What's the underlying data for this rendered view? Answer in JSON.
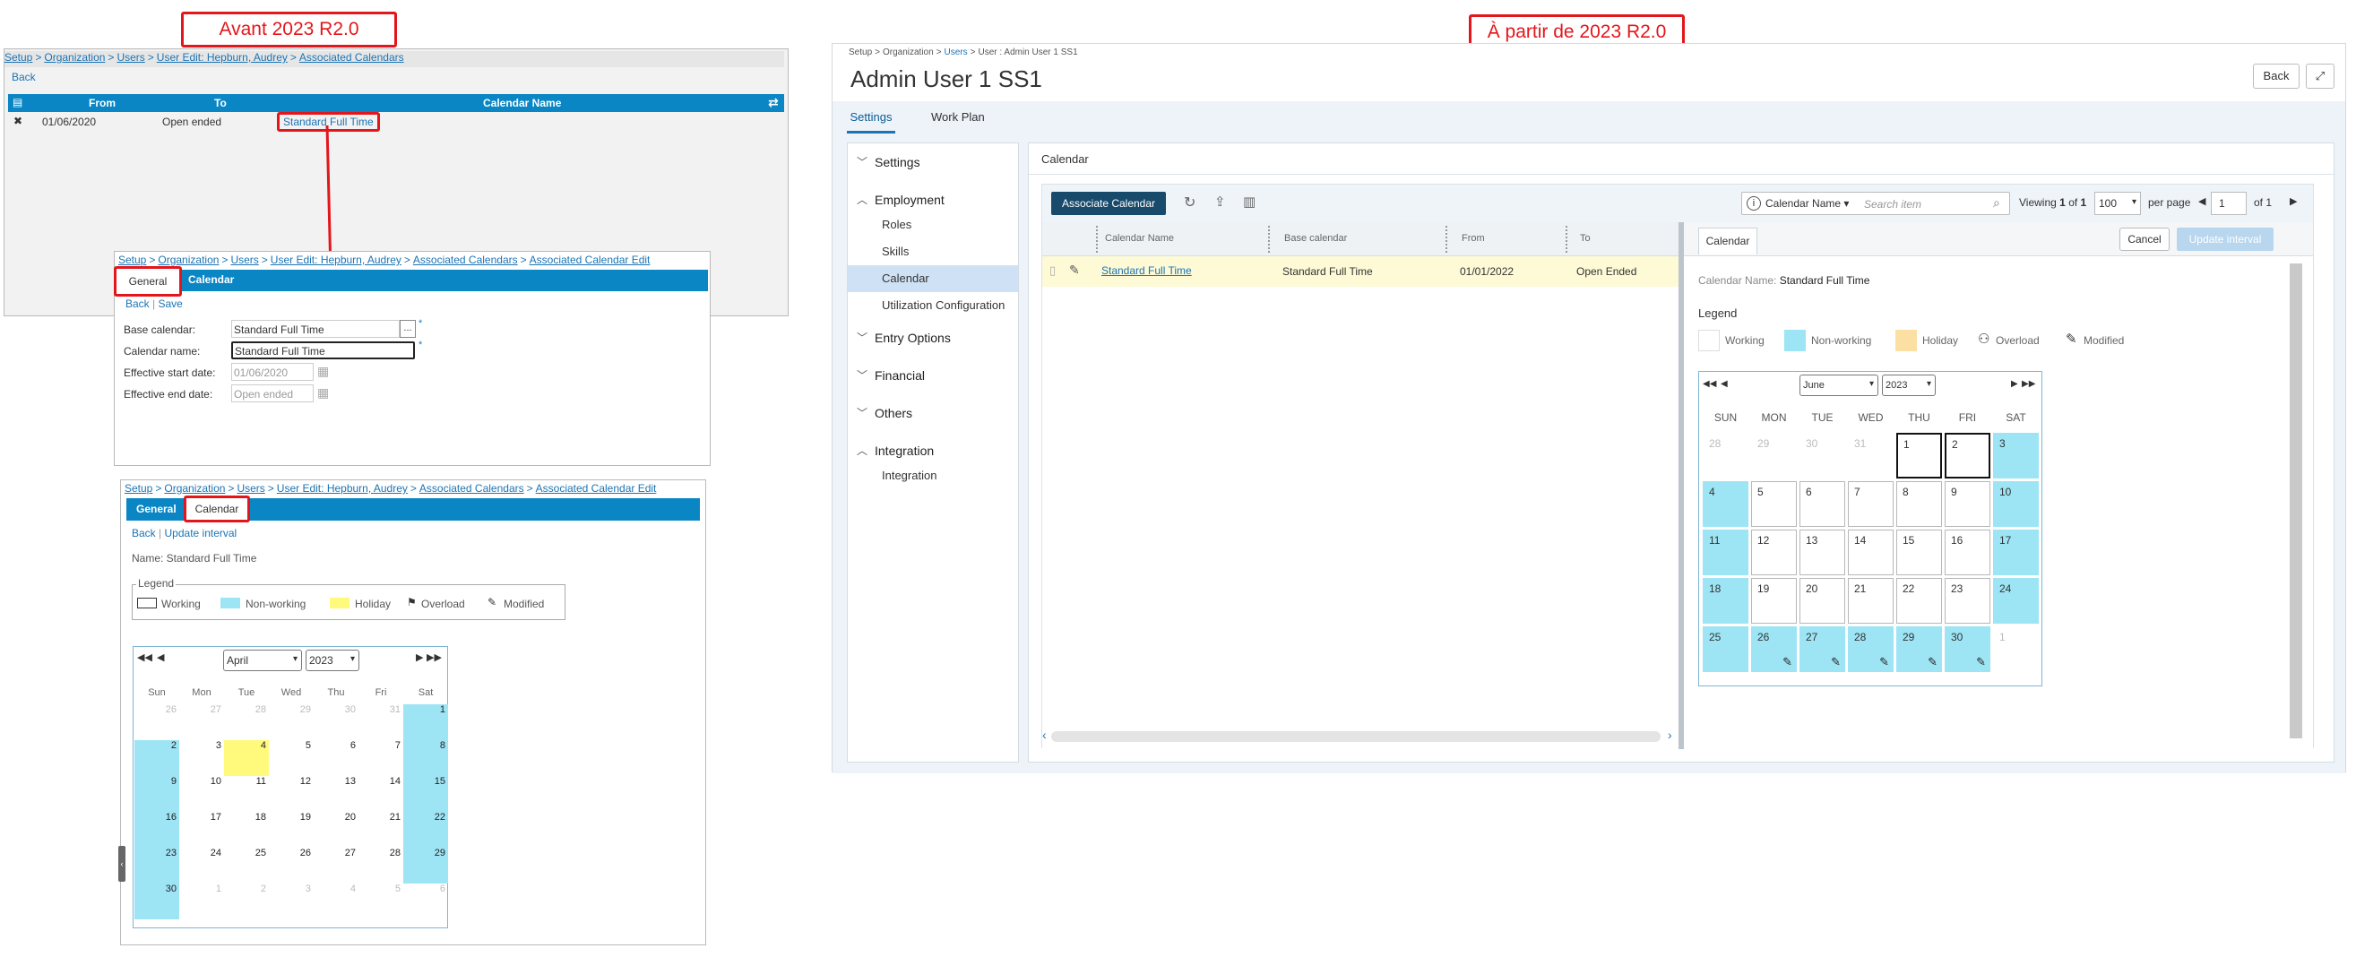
{
  "labels": {
    "before": "Avant 2023 R2.0",
    "after": "À partir de 2023 R2.0"
  },
  "old": {
    "p1": {
      "breadcrumb": [
        "Setup",
        ">",
        "Organization",
        ">",
        "Users",
        ">",
        "User Edit: Hepburn, Audrey",
        ">",
        "Associated Calendars"
      ],
      "back": "Back",
      "columns": [
        "From",
        "To",
        "Calendar Name"
      ],
      "row": {
        "from": "01/06/2020",
        "to": "Open ended",
        "name": "Standard Full Time"
      }
    },
    "p2": {
      "breadcrumb": [
        "Setup",
        ">",
        "Organization",
        ">",
        "Users",
        ">",
        "User Edit: Hepburn, Audrey",
        ">",
        "Associated Calendars",
        ">",
        "Associated Calendar Edit"
      ],
      "tabs": [
        "General",
        "Calendar"
      ],
      "back": "Back",
      "sep": "|",
      "save": "Save",
      "fields": [
        {
          "label": "Base calendar:",
          "value": "Standard Full Time"
        },
        {
          "label": "Calendar name:",
          "value": "Standard Full Time"
        },
        {
          "label": "Effective start date:",
          "value": "01/06/2020"
        },
        {
          "label": "Effective end date:",
          "value": "Open ended"
        }
      ],
      "dots": "...",
      "star": "*"
    },
    "p3": {
      "breadcrumb": [
        "Setup",
        ">",
        "Organization",
        ">",
        "Users",
        ">",
        "User Edit: Hepburn, Audrey",
        ">",
        "Associated Calendars",
        ">",
        "Associated Calendar Edit"
      ],
      "tabs": [
        "General",
        "Calendar"
      ],
      "back": "Back",
      "sep": "|",
      "update": "Update interval",
      "name": "Name: Standard Full Time",
      "legend_title": "Legend",
      "legend": [
        "Working",
        "Non-working",
        "Holiday",
        "Overload",
        "Modified"
      ],
      "month": "April",
      "year": "2023",
      "days": [
        "Sun",
        "Mon",
        "Tue",
        "Wed",
        "Thu",
        "Fri",
        "Sat"
      ],
      "weeks": [
        [
          "26",
          "27",
          "28",
          "29",
          "30",
          "31",
          "1"
        ],
        [
          "2",
          "3",
          "4",
          "5",
          "6",
          "7",
          "8"
        ],
        [
          "9",
          "10",
          "11",
          "12",
          "13",
          "14",
          "15"
        ],
        [
          "16",
          "17",
          "18",
          "19",
          "20",
          "21",
          "22"
        ],
        [
          "23",
          "24",
          "25",
          "26",
          "27",
          "28",
          "29"
        ],
        [
          "30",
          "1",
          "2",
          "3",
          "4",
          "5",
          "6"
        ]
      ]
    }
  },
  "new": {
    "breadcrumb": [
      "Setup",
      ">",
      "Organization",
      ">",
      "Users",
      ">",
      "User : Admin User 1 SS1"
    ],
    "title": "Admin User 1 SS1",
    "back": "Back",
    "tabs": [
      "Settings",
      "Work Plan"
    ],
    "nav": [
      {
        "head": "Settings",
        "open": false,
        "items": []
      },
      {
        "head": "Employment",
        "open": true,
        "items": [
          "Roles",
          "Skills",
          "Calendar",
          "Utilization Configuration"
        ]
      },
      {
        "head": "Entry Options",
        "open": false,
        "items": []
      },
      {
        "head": "Financial",
        "open": false,
        "items": []
      },
      {
        "head": "Others",
        "open": false,
        "items": []
      },
      {
        "head": "Integration",
        "open": true,
        "items": [
          "Integration"
        ]
      }
    ],
    "section_title": "Calendar",
    "associate": "Associate Calendar",
    "filter_field": "Calendar Name",
    "search_placeholder": "Search item",
    "viewing": "Viewing",
    "view_from": "1",
    "of": "of",
    "view_total": "1",
    "per_page_value": "100",
    "per_page": "per page",
    "page": "1",
    "page_of": "of 1",
    "columns": [
      "Calendar Name",
      "Base calendar",
      "From",
      "To"
    ],
    "row": {
      "name": "Standard Full Time",
      "base": "Standard Full Time",
      "from": "01/01/2022",
      "to": "Open Ended"
    },
    "detail": {
      "tab": "Calendar",
      "cancel": "Cancel",
      "update": "Update interval",
      "name_label": "Calendar Name:",
      "name_value": "Standard Full Time",
      "legend_title": "Legend",
      "legend": [
        "Working",
        "Non-working",
        "Holiday",
        "Overload",
        "Modified"
      ],
      "month": "June",
      "year": "2023",
      "days": [
        "SUN",
        "MON",
        "TUE",
        "WED",
        "THU",
        "FRI",
        "SAT"
      ],
      "weeks": [
        [
          "28",
          "29",
          "30",
          "31",
          "1",
          "2",
          "3"
        ],
        [
          "4",
          "5",
          "6",
          "7",
          "8",
          "9",
          "10"
        ],
        [
          "11",
          "12",
          "13",
          "14",
          "15",
          "16",
          "17"
        ],
        [
          "18",
          "19",
          "20",
          "21",
          "22",
          "23",
          "24"
        ],
        [
          "25",
          "26",
          "27",
          "28",
          "29",
          "30",
          "1"
        ]
      ]
    }
  }
}
